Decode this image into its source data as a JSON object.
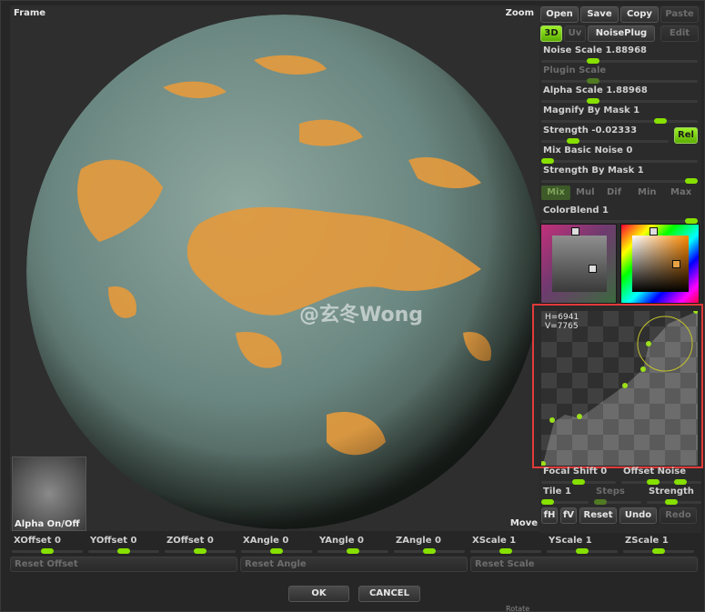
{
  "viewport": {
    "frame_label": "Frame",
    "zoom_label": "Zoom",
    "move_label": "Move",
    "alpha_label": "Alpha On/Off",
    "watermark": "@玄冬Wong"
  },
  "toolbar": {
    "open": "Open",
    "save": "Save",
    "copy": "Copy",
    "paste": "Paste",
    "mode_3d": "3D",
    "uv": "Uv",
    "noiseplug": "NoisePlug",
    "edit": "Edit"
  },
  "sliders": {
    "noise_scale": "Noise Scale  1.88968",
    "plugin_scale": "Plugin Scale",
    "alpha_scale": "Alpha Scale  1.88968",
    "magnify_by_mask": "Magnify By Mask 1",
    "strength": "Strength -0.02333",
    "rel": "Rel",
    "mix_basic_noise": "Mix Basic Noise 0",
    "strength_by_mask": "Strength By Mask 1",
    "colorblend": "ColorBlend 1",
    "focal_shift": "Focal Shift 0",
    "offset_noise": "Offset Noise",
    "tile": "Tile 1",
    "steps": "Steps",
    "strength2": "Strength"
  },
  "blend_modes": [
    "Mix",
    "Mul",
    "Dif",
    "Min",
    "Max"
  ],
  "curve": {
    "h": "H=6941",
    "v": "V=7765"
  },
  "curve_buttons": {
    "fh": "fH",
    "fv": "fV",
    "reset": "Reset",
    "undo": "Undo",
    "redo": "Redo"
  },
  "bottom": {
    "xoffset": "XOffset 0",
    "yoffset": "YOffset 0",
    "zoffset": "ZOffset 0",
    "xangle": "XAngle 0",
    "yangle": "YAngle 0",
    "zangle": "ZAngle 0",
    "xscale": "XScale 1",
    "yscale": "YScale 1",
    "zscale": "ZScale 1",
    "reset_offset": "Reset Offset",
    "reset_angle": "Reset Angle",
    "reset_scale": "Reset Scale"
  },
  "dialog": {
    "ok": "OK",
    "cancel": "CANCEL"
  },
  "background_label": "Rotate",
  "colors": {
    "accent": "#86e000",
    "highlight_frame": "#e23a3a",
    "sphere_base": "#6f8e88",
    "sphere_orange": "#e8a243"
  }
}
